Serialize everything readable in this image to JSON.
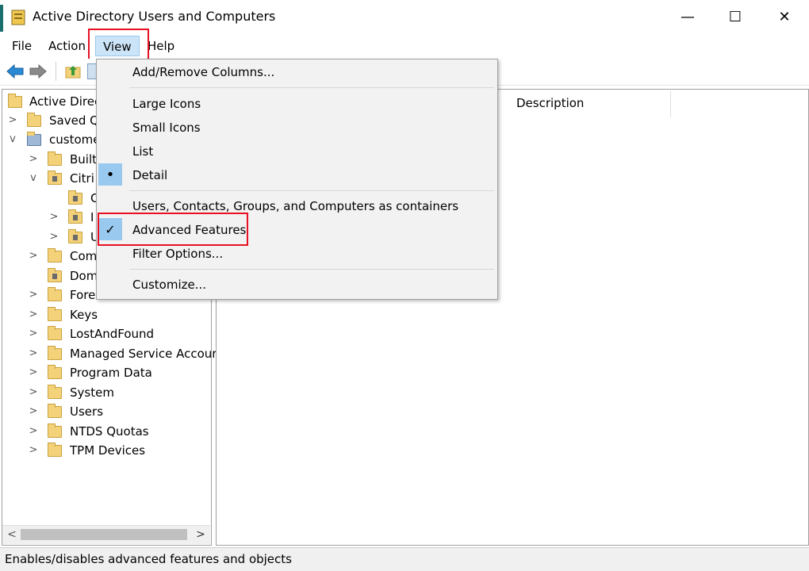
{
  "window": {
    "title": "Active Directory Users and Computers",
    "minimize_glyph": "—",
    "maximize_glyph": "☐",
    "close_glyph": "✕"
  },
  "menubar": {
    "items": [
      {
        "label": "File"
      },
      {
        "label": "Action"
      },
      {
        "label": "View"
      },
      {
        "label": "Help"
      }
    ]
  },
  "toolbar": {
    "icons": [
      "back-arrow-icon",
      "forward-arrow-icon",
      "up-folder-icon",
      "show-tree-icon"
    ]
  },
  "tree": {
    "root_label": "Active Direc",
    "items": [
      {
        "label": "Saved Q",
        "chevron": ">"
      },
      {
        "label": "custome",
        "chevron": "v"
      },
      {
        "label": "Built",
        "chevron": ">"
      },
      {
        "label": "Citri",
        "chevron": "v"
      },
      {
        "label": "C",
        "chevron": ""
      },
      {
        "label": "I",
        "chevron": ">"
      },
      {
        "label": "U",
        "chevron": ">"
      },
      {
        "label": "Com",
        "chevron": ">"
      },
      {
        "label": "Dom",
        "chevron": ""
      },
      {
        "label": "Forei",
        "chevron": ">"
      },
      {
        "label": "Keys",
        "chevron": ">"
      },
      {
        "label": "LostAndFound",
        "chevron": ">"
      },
      {
        "label": "Managed Service Accour",
        "chevron": ">"
      },
      {
        "label": "Program Data",
        "chevron": ">"
      },
      {
        "label": "System",
        "chevron": ">"
      },
      {
        "label": "Users",
        "chevron": ">"
      },
      {
        "label": "NTDS Quotas",
        "chevron": ">"
      },
      {
        "label": "TPM Devices",
        "chevron": ">"
      }
    ],
    "scroll_left": "<",
    "scroll_right": ">"
  },
  "list": {
    "columns": [
      {
        "label": "Description"
      }
    ]
  },
  "view_menu": {
    "items": [
      {
        "label": "Add/Remove Columns..."
      },
      {
        "label": "Large Icons"
      },
      {
        "label": "Small Icons"
      },
      {
        "label": "List"
      },
      {
        "label": "Detail",
        "marker": "•"
      },
      {
        "label": "Users, Contacts, Groups, and Computers as containers"
      },
      {
        "label": "Advanced Features",
        "marker": "✓"
      },
      {
        "label": "Filter Options..."
      },
      {
        "label": "Customize..."
      }
    ]
  },
  "statusbar": {
    "text": "Enables/disables advanced features and objects"
  },
  "colors": {
    "highlight_box": "#e81123",
    "menu_selected": "#cce4f7",
    "checked_marker": "#99c9ef"
  }
}
